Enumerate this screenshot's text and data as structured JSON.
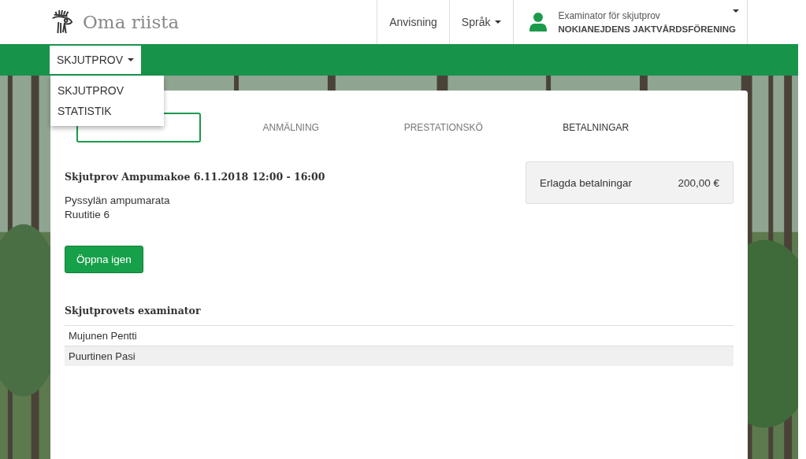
{
  "header": {
    "logo_text": "Oma riista",
    "nav": [
      {
        "label": "Anvisning",
        "kind": "link"
      },
      {
        "label": "Språk",
        "kind": "dropdown"
      }
    ],
    "user": {
      "role": "Examinator för skjutprov",
      "organization": "NOKIANEJDENS JAKTVÅRDSFÖRENING"
    }
  },
  "subnav": {
    "menu": {
      "label": "SKJUTPROV",
      "expanded": true,
      "items": [
        "SKJUTPROV",
        "STATISTIK"
      ]
    }
  },
  "tabs": [
    {
      "selected": true
    },
    {
      "label": "ANMÄLNING",
      "selected": false
    },
    {
      "label": "PRESTATIONSKÖ",
      "selected": false
    },
    {
      "label": "BETALNINGAR",
      "selected": false
    }
  ],
  "event": {
    "title": "Skjutprov Ampumakoe 6.11.2018 12:00 - 16:00",
    "place": "Pyssylän ampumarata",
    "address": "Ruutitie 6",
    "reopen_button": "Öppna igen"
  },
  "payments": {
    "label": "Erlagda betalningar",
    "amount": "200,00 €"
  },
  "examiners": {
    "title": "Skjutprovets examinator",
    "rows": [
      "Mujunen Pentti",
      "Puurtinen Pasi"
    ]
  }
}
